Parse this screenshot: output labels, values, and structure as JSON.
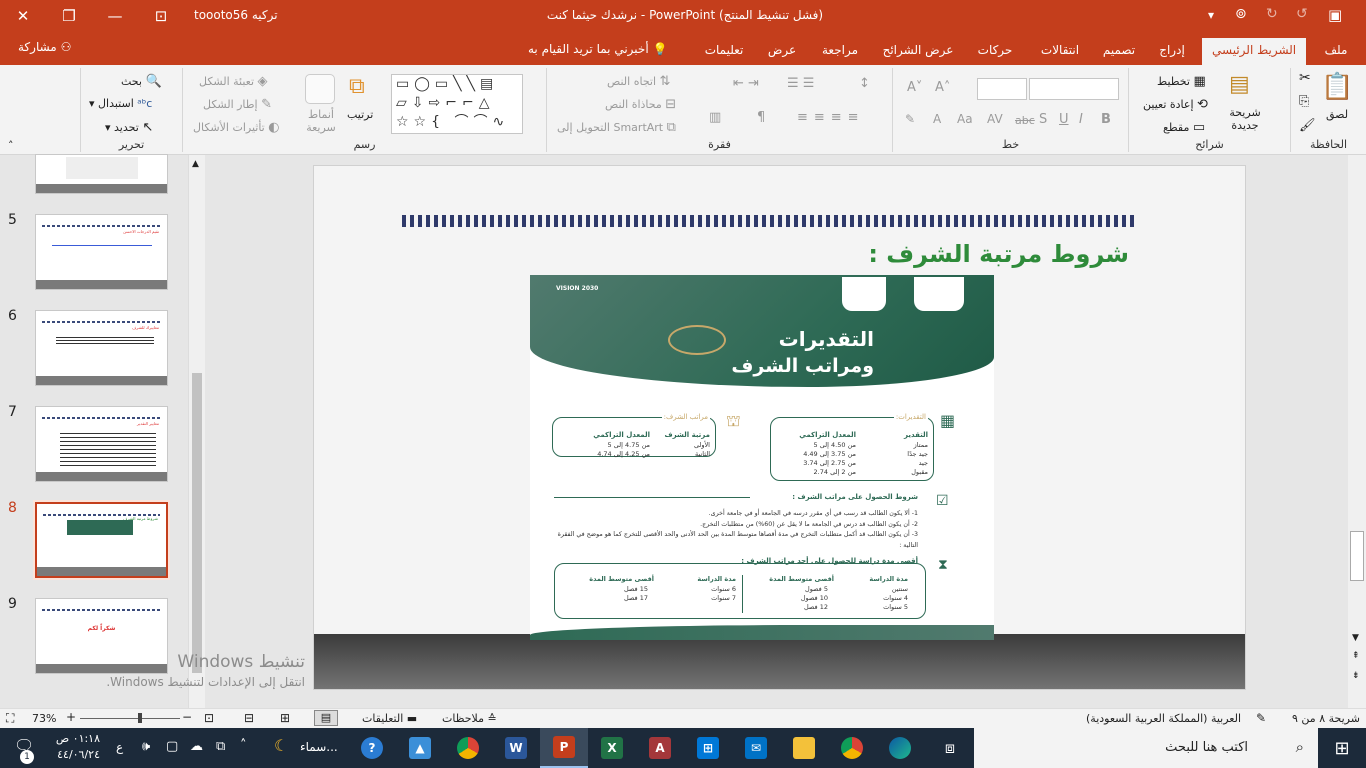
{
  "titlebar": {
    "title": "نرشدك حيثما كنت - PowerPoint (فشل تنشيط المنتج)",
    "user": "toooto56 تركيه",
    "colors": {
      "accent": "#c43e1c"
    }
  },
  "tabs": [
    "ملف",
    "الشريط الرئيسي",
    "إدراج",
    "تصميم",
    "انتقالات",
    "حركات",
    "عرض الشرائح",
    "مراجعة",
    "عرض",
    "تعليمات"
  ],
  "tell_me": "أخبرني بما تريد القيام به",
  "share": "مشاركة",
  "ribbon": {
    "clipboard": {
      "label": "الحافظة",
      "paste": "لصق"
    },
    "slides": {
      "label": "شرائح",
      "new_slide": "شريحة جديدة",
      "layout": "تخطيط",
      "reset": "إعادة تعيين",
      "section": "مقطع"
    },
    "font": {
      "label": "خط"
    },
    "paragraph": {
      "label": "فقرة",
      "text_direction": "اتجاه النص",
      "align_text": "محاذاة النص",
      "smartart": "التحويل إلى SmartArt"
    },
    "drawing": {
      "label": "رسم",
      "arrange": "ترتيب",
      "quick_styles": "أنماط سريعة",
      "shape_fill": "تعبئة الشكل",
      "shape_outline": "إطار الشكل",
      "shape_effects": "تأثيرات الأشكال"
    },
    "editing": {
      "label": "تحرير",
      "find": "بحث",
      "replace": "استبدال",
      "select": "تحديد"
    }
  },
  "thumbnails": [
    {
      "num": "5",
      "text": "تقيم الدرجات الاحسن"
    },
    {
      "num": "6",
      "text": "معاييرك للشرف"
    },
    {
      "num": "7",
      "text": "معايير التقدير"
    },
    {
      "num": "8",
      "text": "شروط مرتبة الشرف"
    },
    {
      "num": "9",
      "text": "شكراً لكم"
    }
  ],
  "slide": {
    "heading": "شروط مرتبة الشرف :",
    "poster": {
      "vision": "VISION 2030",
      "title_line1": "التقديرات",
      "title_line2": "ومراتب الشرف",
      "grades_title": "التقديرات:",
      "grades_headers": [
        "التقدير",
        "المعدل التراكمي"
      ],
      "grades": [
        {
          "name": "ممتاز",
          "range": "من 4.50 إلى 5"
        },
        {
          "name": "جيد جدًا",
          "range": "من 3.75 إلى 4.49"
        },
        {
          "name": "جيد",
          "range": "من 2.75 إلى 3.74"
        },
        {
          "name": "مقبول",
          "range": "من 2 إلى 2.74"
        }
      ],
      "honors_title": "مراتب الشرف:",
      "honors_headers": [
        "مرتبة الشرف",
        "المعدل التراكمي"
      ],
      "honors": [
        {
          "name": "الأولى",
          "range": "من 4.75 إلى 5"
        },
        {
          "name": "الثانية",
          "range": "من 4.25 إلى 4.74"
        }
      ],
      "conditions_title": "شروط الحصول على مراتب الشرف :",
      "conditions": [
        "1- ألا يكون الطالب قد رسب في أي مقرر درسه في الجامعة أو في جامعة أخرى.",
        "2- أن يكون الطالب قد درس في الجامعة ما لا يقل عن (60%) من متطلبات التخرج.",
        "3- أن يكون الطالب قد أكمل متطلبات التخرج في مدة أقصاها متوسط المدة بين الحد الأدنى والحد الأقصى للتخرج كما هو موضح في الفقرة التالية :"
      ],
      "duration_title": "أقصى مدة دراسة للحصول على أحد مراتب الشرف :",
      "duration_headers": [
        "مدة الدراسة",
        "أقصى متوسط المدة"
      ],
      "durations_right": [
        {
          "study": "سنتين",
          "max": "5 فصول"
        },
        {
          "study": "4 سنوات",
          "max": "10 فصول"
        },
        {
          "study": "5 سنوات",
          "max": "12 فصل"
        }
      ],
      "durations_left": [
        {
          "study": "6 سنوات",
          "max": "15 فصل"
        },
        {
          "study": "7 سنوات",
          "max": "17 فصل"
        }
      ]
    }
  },
  "watermark": {
    "line1": "تنشيط Windows",
    "line2": "انتقل إلى الإعدادات لتنشيط Windows."
  },
  "statusbar": {
    "slide_info": "شريحة ٨ من ٩",
    "language": "العربية (المملكة العربية السعودية)",
    "notes": "ملاحظات",
    "comments": "التعليقات",
    "zoom": "73%"
  },
  "taskbar": {
    "search_placeholder": "اكتب هنا للبحث",
    "time": "٠١:١٨ ص",
    "date": "٤٤/٠٦/٢٤",
    "lang": "ع",
    "weather": "سماء...",
    "notif_count": "1"
  }
}
